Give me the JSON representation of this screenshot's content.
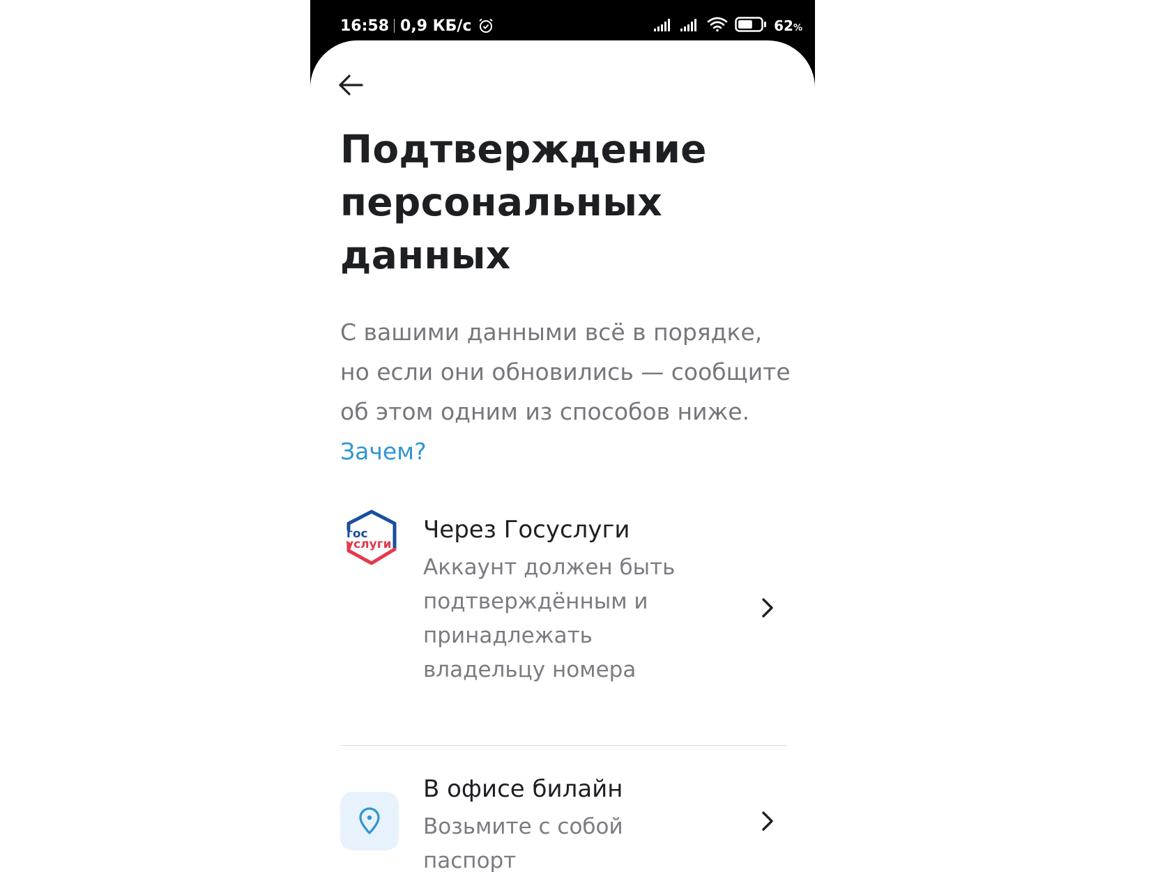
{
  "statusbar": {
    "time": "16:58",
    "net_speed": "0,9 КБ/с",
    "battery_pct": "62",
    "battery_unit": "%",
    "battery_level": 0.62,
    "icons": [
      "alarm-icon",
      "signal-icon",
      "signal-icon",
      "wifi-icon",
      "battery-icon"
    ]
  },
  "header": {
    "back_icon": "arrow-left-icon"
  },
  "page": {
    "title_lines": [
      "Подтверждение",
      "персональных",
      "данных"
    ],
    "description": "С вашими данными всё в порядке, но если они обновились — сообщите об этом одним из способов ниже.",
    "why_link": "Зачем?"
  },
  "options": [
    {
      "icon": "gosuslugi-logo",
      "logo_text_top": "гос",
      "logo_text_bottom": "услуги",
      "title": "Через Госуслуги",
      "subtitle": "Аккаунт должен быть подтверждённым и принадлежать владельцу номера"
    },
    {
      "icon": "location-pin-icon",
      "title": "В офисе билайн",
      "subtitle": "Возьмите с собой паспорт"
    }
  ],
  "colors": {
    "text_primary": "#1e1f22",
    "text_secondary": "#75777c",
    "link": "#2f96d3",
    "gosuslugi_blue": "#1b4f9c",
    "gosuslugi_red": "#e33a4f",
    "pin_bg": "#e7f2fc"
  }
}
